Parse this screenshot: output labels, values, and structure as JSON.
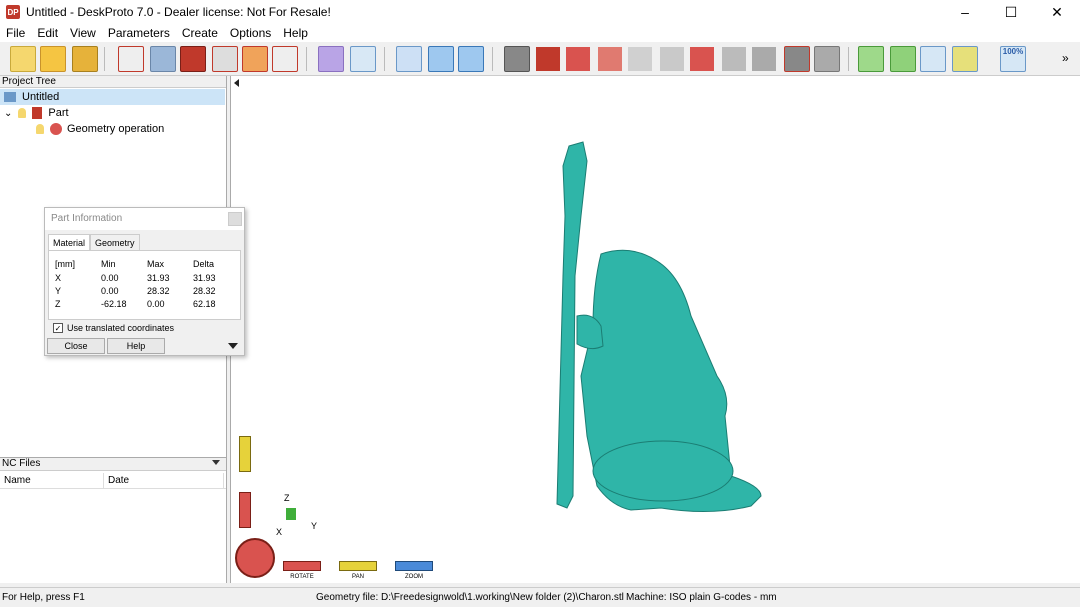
{
  "window": {
    "title": "Untitled - DeskProto 7.0 - Dealer license: Not For Resale!",
    "logo": "DP",
    "minimize": "–",
    "maximize": "☐",
    "close": "✕"
  },
  "menu": [
    "File",
    "Edit",
    "View",
    "Parameters",
    "Create",
    "Options",
    "Help"
  ],
  "toolbar": {
    "zoom_percent": "100%",
    "overflow": "»"
  },
  "project_tree": {
    "header": "Project Tree",
    "root": "Untitled",
    "part": "Part",
    "operation": "Geometry operation"
  },
  "nc_files": {
    "header": "NC Files",
    "columns": [
      "Name",
      "Date"
    ]
  },
  "part_information": {
    "title": "Part Information",
    "tabs": [
      "Material",
      "Geometry"
    ],
    "headers": [
      "[mm]",
      "Min",
      "Max",
      "Delta"
    ],
    "rows": [
      {
        "axis": "X",
        "min": "0.00",
        "max": "31.93",
        "delta": "31.93"
      },
      {
        "axis": "Y",
        "min": "0.00",
        "max": "28.32",
        "delta": "28.32"
      },
      {
        "axis": "Z",
        "min": "-62.18",
        "max": "0.00",
        "delta": "62.18"
      }
    ],
    "checkbox_label": "Use translated coordinates",
    "checkbox_checked": true,
    "close_label": "Close",
    "help_label": "Help"
  },
  "viewport": {
    "axis_z": "Z",
    "axis_y": "Y",
    "axis_x": "X",
    "rotate_label": "ROTATE",
    "pan_label": "PAN",
    "zoom_label": "ZOOM",
    "model_color": "#2fb5a8"
  },
  "status": {
    "help": "For Help, press F1",
    "geometry": "Geometry file: D:\\Freedesignwold\\1.working\\New folder (2)\\Charon.stl",
    "machine": "Machine: ISO plain G-codes - mm"
  }
}
